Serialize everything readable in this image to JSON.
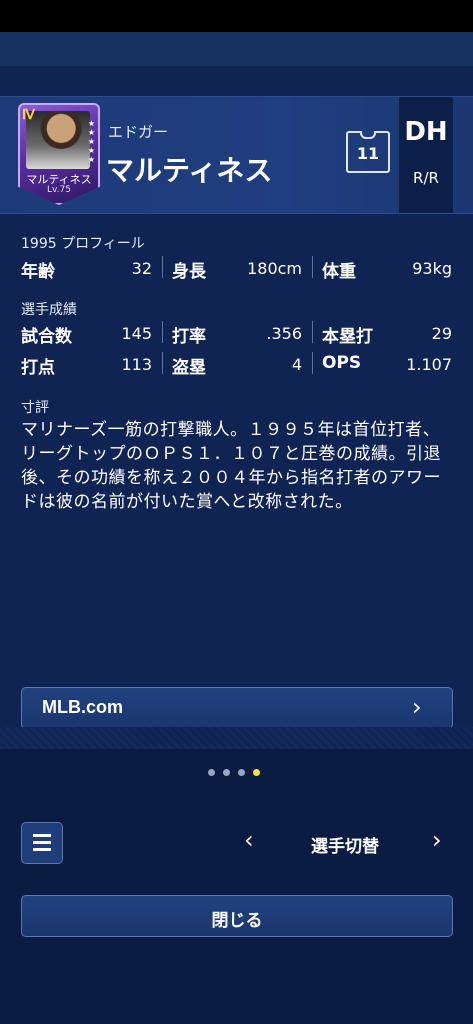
{
  "player": {
    "card_rank": "Ⅳ",
    "card_name": "マルティネス",
    "card_level": "Lv.75",
    "first_name": "エドガー",
    "last_name": "マルティネス",
    "number": "11",
    "position": "DH",
    "handedness": "R/R"
  },
  "profile": {
    "section": "1995 プロフィール",
    "age_label": "年齢",
    "age": "32",
    "height_label": "身長",
    "height": "180cm",
    "weight_label": "体重",
    "weight": "93kg"
  },
  "stats": {
    "section": "選手成績",
    "games_label": "試合数",
    "games": "145",
    "avg_label": "打率",
    "avg": ".356",
    "hr_label": "本塁打",
    "hr": "29",
    "rbi_label": "打点",
    "rbi": "113",
    "sb_label": "盗塁",
    "sb": "4",
    "ops_label": "OPS",
    "ops": "1.107"
  },
  "review": {
    "section": "寸評",
    "text": "マリナーズ一筋の打撃職人。１９９５年は首位打者、リーグトップのＯＰＳ１．１０７と圧巻の成績。引退後、その功績を称え２００４年から指名打者のアワードは彼の名前が付いた賞へと改称された。"
  },
  "link": {
    "label": "MLB.com"
  },
  "pager": {
    "count": 4,
    "active": 4
  },
  "nav": {
    "switch_label": "選手切替",
    "close_label": "閉じる"
  },
  "icons": {
    "menu": "menu-icon",
    "prev": "chevron-left-icon",
    "next": "chevron-right-icon",
    "link_arrow": "chevron-right-icon"
  },
  "colors": {
    "background": "#0f2453",
    "header": "#1f3d7d",
    "active_dot": "#ffe23a",
    "card": "#8b5cd6"
  }
}
